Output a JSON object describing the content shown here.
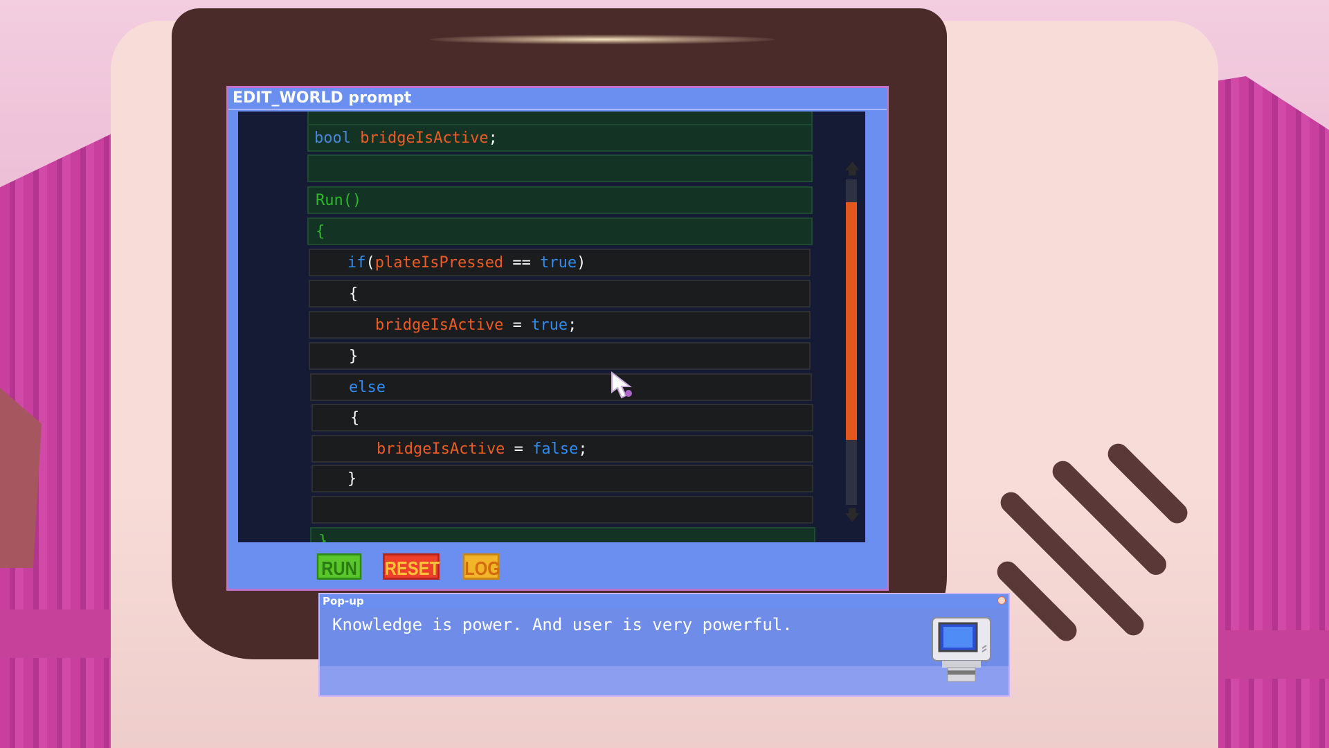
{
  "window": {
    "title": "EDIT_WORLD prompt"
  },
  "code": {
    "line1": {
      "type": "bool",
      "var": "bridgeIsActive",
      "semi": ";"
    },
    "line3": {
      "fn": "Run()"
    },
    "line4": {
      "brace": "{"
    },
    "line5": {
      "kw": "if",
      "open": "(",
      "var": "plateIsPressed",
      "op": " == ",
      "val": "true",
      "close": ")"
    },
    "line6": {
      "brace": "{"
    },
    "line7": {
      "var": "bridgeIsActive",
      "op": " = ",
      "val": "true",
      "semi": ";"
    },
    "line8": {
      "brace": "}"
    },
    "line9": {
      "kw": "else"
    },
    "line10": {
      "brace": "{"
    },
    "line11": {
      "var": "bridgeIsActive",
      "op": " = ",
      "val": "false",
      "semi": ";"
    },
    "line12": {
      "brace": "}"
    },
    "line14": {
      "brace": "}"
    }
  },
  "scrollbar": {
    "up": "🡅",
    "down": "🡇",
    "position_fraction": 0.07,
    "visible_fraction": 0.73
  },
  "toolbar": {
    "run_label": "RUN",
    "reset_label": "RESET",
    "log_label": "LOG"
  },
  "popup": {
    "title": "Pop-up",
    "message": "Knowledge is power. And user is very powerful."
  },
  "colors": {
    "window_blue": "#6b8ff0",
    "editor_bg": "#151a35",
    "keyword": "#2f8cf0",
    "variable": "#ef5c23",
    "function": "#2fb82c",
    "thumb": "#e2571c"
  },
  "icons": {
    "popup_icon": "retro-computer-icon",
    "close": "close-icon",
    "cursor": "mouse-cursor-icon"
  }
}
